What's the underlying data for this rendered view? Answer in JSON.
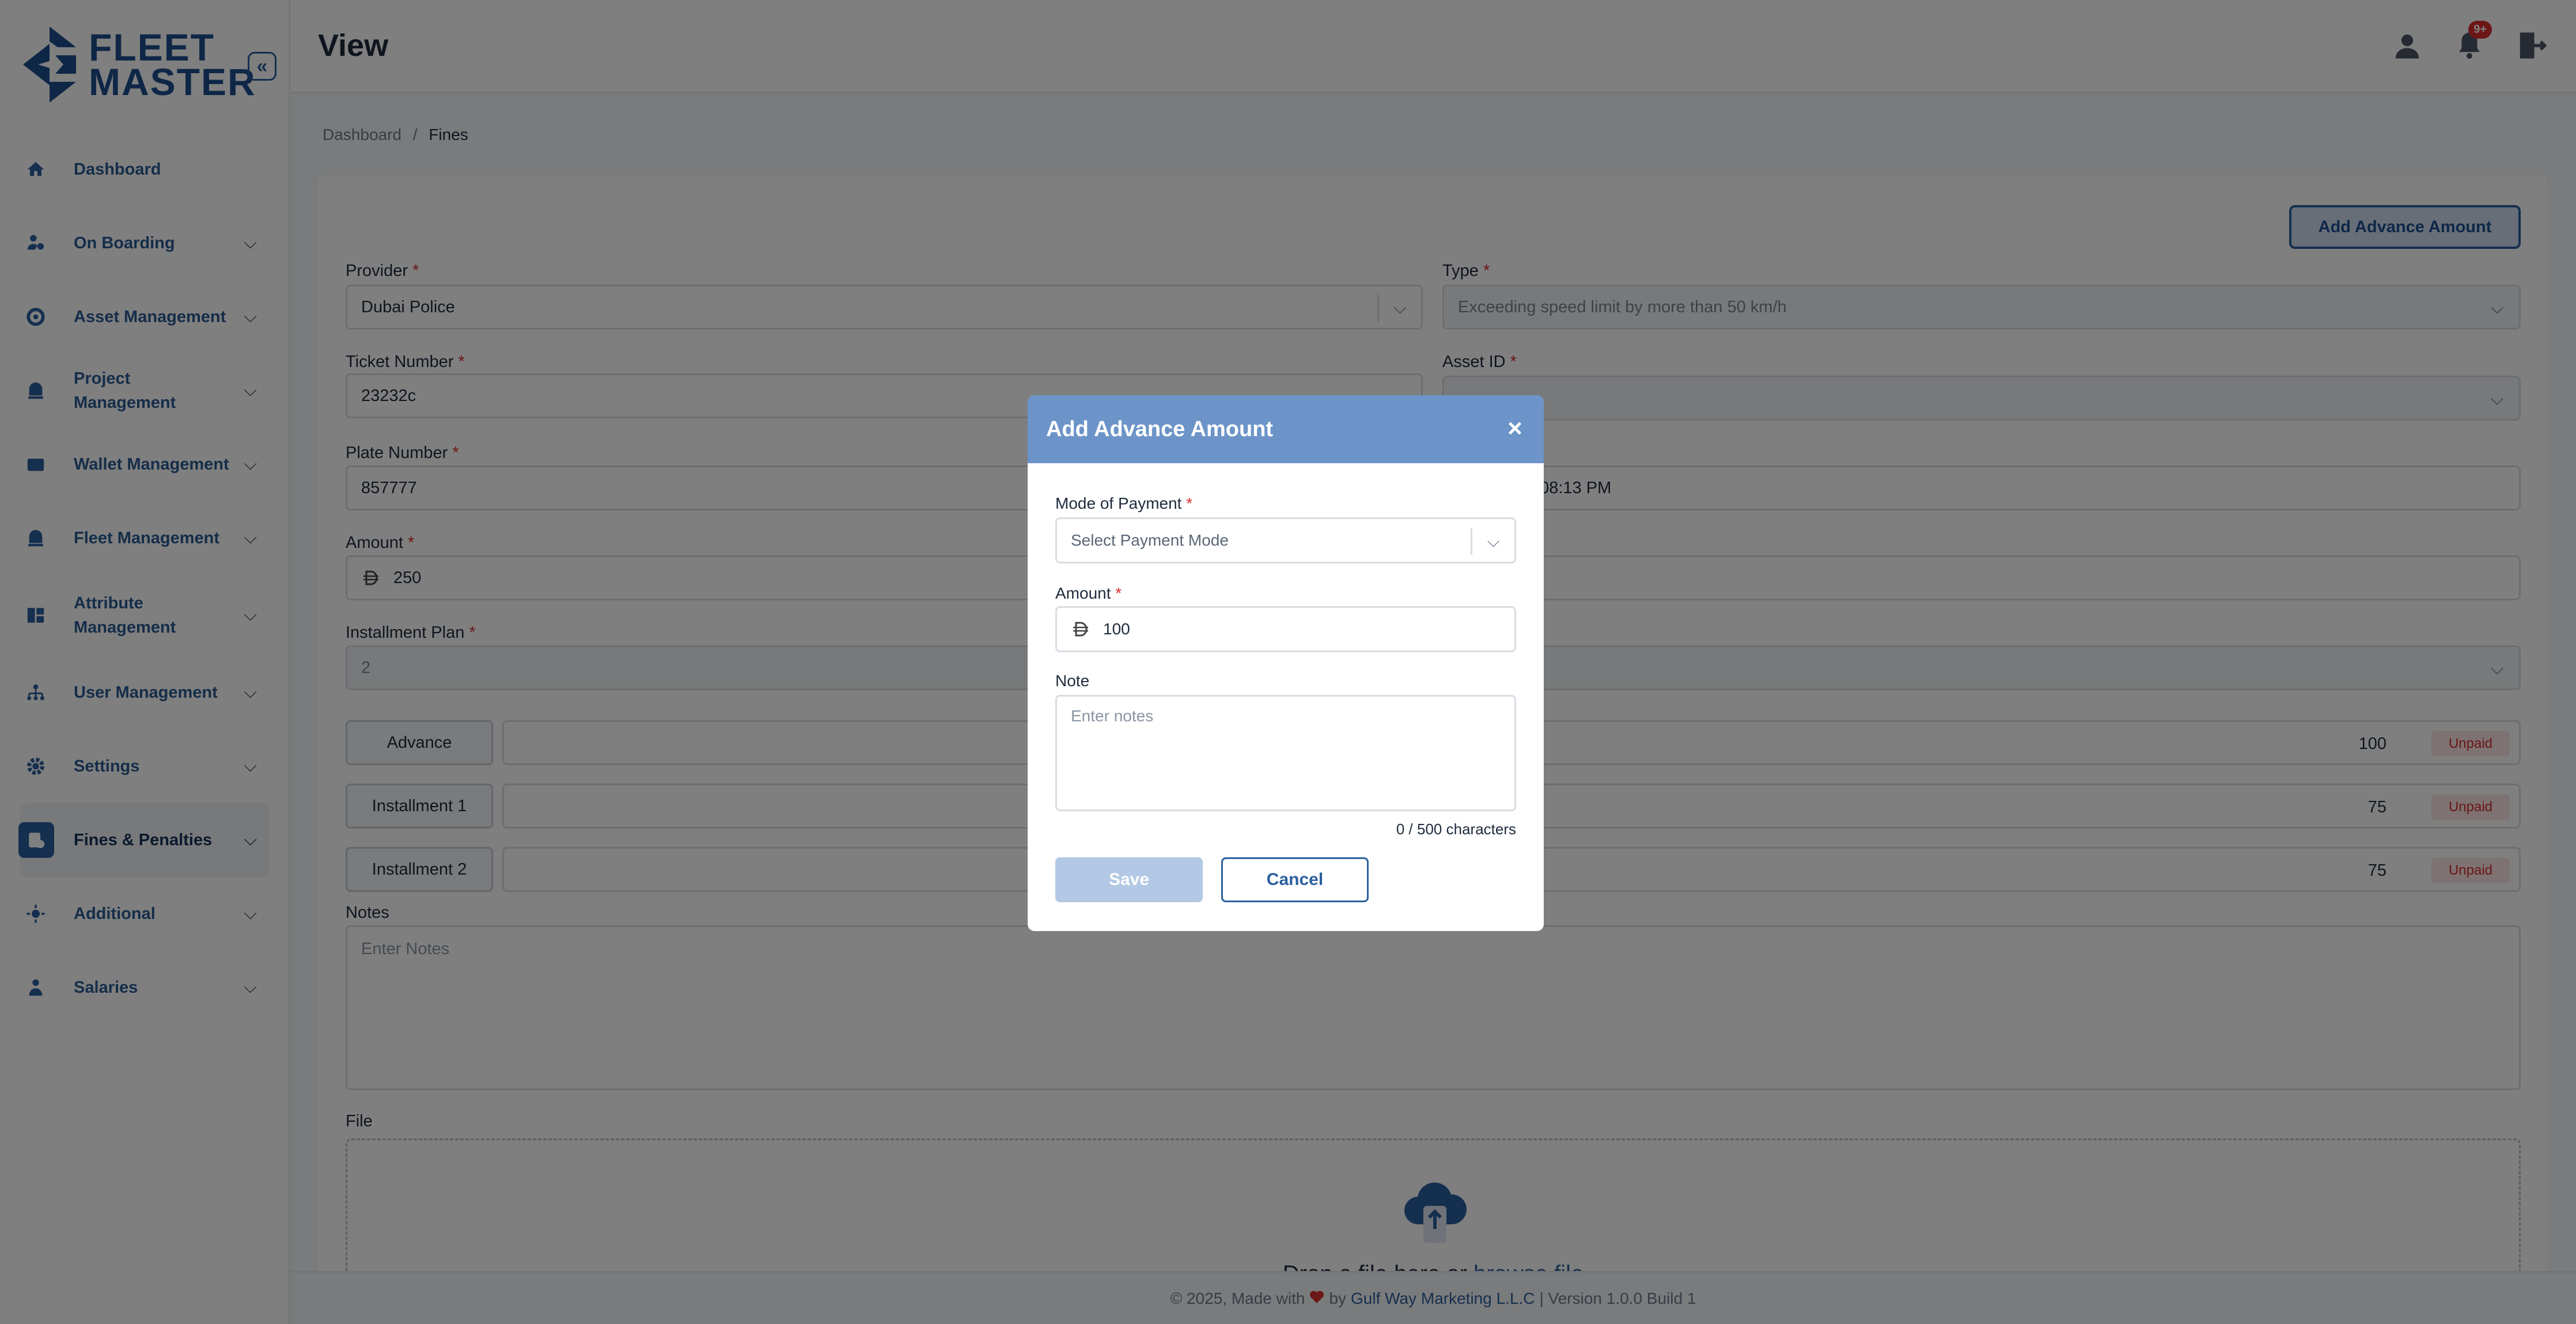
{
  "brand": {
    "line1": "FLEET",
    "line2": "MASTER"
  },
  "header": {
    "title": "View",
    "notification_count": "9+"
  },
  "sidebar": {
    "items": [
      {
        "label": "Dashboard",
        "icon": "home-icon",
        "has_chevron": false
      },
      {
        "label": "On Boarding",
        "icon": "onboarding-icon",
        "has_chevron": true
      },
      {
        "label": "Asset Management",
        "icon": "asset-icon",
        "has_chevron": true
      },
      {
        "label": "Project Management",
        "icon": "project-icon",
        "has_chevron": true
      },
      {
        "label": "Wallet Management",
        "icon": "wallet-icon",
        "has_chevron": true
      },
      {
        "label": "Fleet Management",
        "icon": "fleet-icon",
        "has_chevron": true
      },
      {
        "label": "Attribute Management",
        "icon": "attribute-icon",
        "has_chevron": true
      },
      {
        "label": "User Management",
        "icon": "user-mgmt-icon",
        "has_chevron": true
      },
      {
        "label": "Settings",
        "icon": "gear-icon",
        "has_chevron": true
      },
      {
        "label": "Fines & Penalties",
        "icon": "fines-icon",
        "has_chevron": true,
        "active": true
      },
      {
        "label": "Additional",
        "icon": "additional-icon",
        "has_chevron": true
      },
      {
        "label": "Salaries",
        "icon": "salaries-icon",
        "has_chevron": true
      }
    ]
  },
  "breadcrumb": {
    "root": "Dashboard",
    "sep": "/",
    "current": "Fines"
  },
  "form": {
    "add_advance_label": "Add Advance Amount",
    "provider": {
      "label": "Provider",
      "value": "Dubai Police"
    },
    "type": {
      "label": "Type",
      "value": "Exceeding speed limit by more than 50 km/h"
    },
    "ticket_number": {
      "label": "Ticket Number",
      "value": "23232c"
    },
    "asset_id": {
      "label": "Asset ID",
      "value": ""
    },
    "plate_number": {
      "label": "Plate Number",
      "value": "857777"
    },
    "date_value": ", 08:13 PM",
    "amount": {
      "label": "Amount",
      "value": "250"
    },
    "installment_plan": {
      "label": "Installment Plan",
      "value": "2"
    },
    "installments": [
      {
        "label": "Advance",
        "amount": "100",
        "status": "Unpaid"
      },
      {
        "label": "Installment 1",
        "amount": "75",
        "status": "Unpaid"
      },
      {
        "label": "Installment 2",
        "amount": "75",
        "status": "Unpaid"
      }
    ],
    "notes": {
      "label": "Notes",
      "placeholder": "Enter Notes"
    },
    "file": {
      "label": "File",
      "drop_text": "Drop a file here",
      "or": " or ",
      "browse": "browse file"
    }
  },
  "modal": {
    "title": "Add Advance Amount",
    "close": "×",
    "mode_label": "Mode of Payment",
    "mode_placeholder": "Select Payment Mode",
    "amount_label": "Amount",
    "amount_value": "100",
    "note_label": "Note",
    "note_placeholder": "Enter notes",
    "char_count": "0 / 500 characters",
    "save": "Save",
    "cancel": "Cancel"
  },
  "footer": {
    "prefix": "© 2025, Made with",
    "by": "by",
    "company": "Gulf Way Marketing L.L.C",
    "suffix": "| Version 1.0.0 Build 1"
  },
  "colors": {
    "brand": "#2b5f9e",
    "modal_header": "#6c94c8",
    "danger": "#d92c2c"
  },
  "required_mark": "*",
  "currency_icon": "dirham-icon",
  "chevron": "⌵",
  "collapse_icon": "«"
}
